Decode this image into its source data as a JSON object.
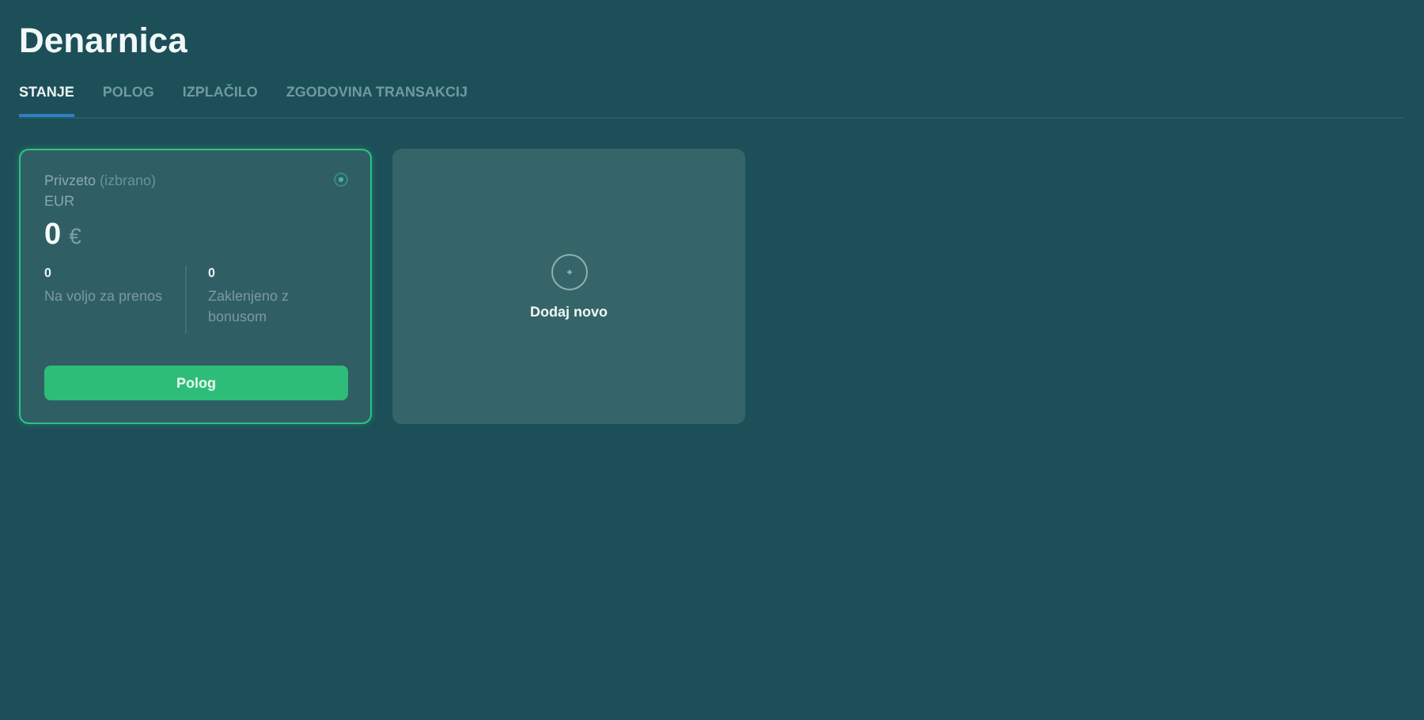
{
  "page": {
    "title": "Denarnica"
  },
  "tabs": [
    {
      "label": "STANJE",
      "selected": true
    },
    {
      "label": "POLOG",
      "selected": false
    },
    {
      "label": "IZPLAČILO",
      "selected": false
    },
    {
      "label": "ZGODOVINA TRANSAKCIJ",
      "selected": false
    }
  ],
  "wallets": [
    {
      "label": "Privzeto",
      "note": "(izbrano)",
      "currency": "EUR",
      "amount": "0",
      "symbol": "€",
      "selected": true,
      "stats": [
        {
          "value": "0",
          "label": "Na voljo za prenos"
        },
        {
          "value": "0",
          "label": "Zaklenjeno z bonusom"
        }
      ],
      "button": "Polog"
    }
  ],
  "add_card": {
    "label": "Dodaj novo"
  }
}
